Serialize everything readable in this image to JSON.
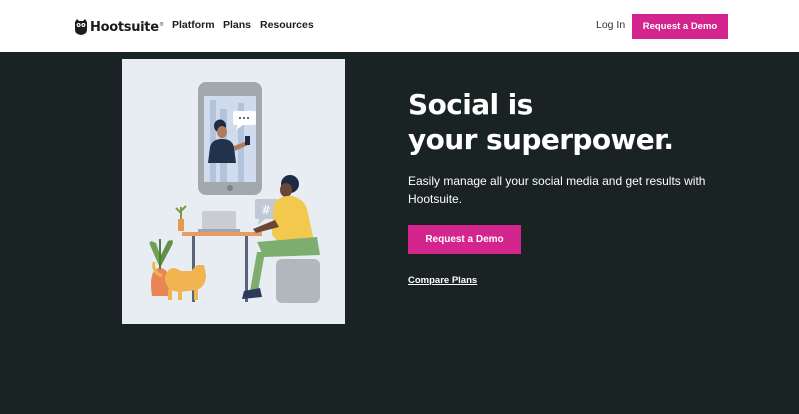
{
  "nav": {
    "brand": "Hootsuite",
    "brand_mark": "®",
    "links": [
      "Platform",
      "Plans",
      "Resources"
    ],
    "login": "Log In",
    "demo_button": "Request a Demo"
  },
  "hero": {
    "title_line1": "Social is",
    "title_line2": "your superpower.",
    "subtitle": "Easily manage all your social media and get results with Hootsuite.",
    "demo_button": "Request a Demo",
    "compare_link": "Compare Plans"
  },
  "colors": {
    "background": "#1a2323",
    "accent": "#d4258f",
    "nav_background": "#ffffff",
    "illustration_background": "#e8ecf3"
  },
  "icons": {
    "logo": "owl-logo-icon"
  }
}
